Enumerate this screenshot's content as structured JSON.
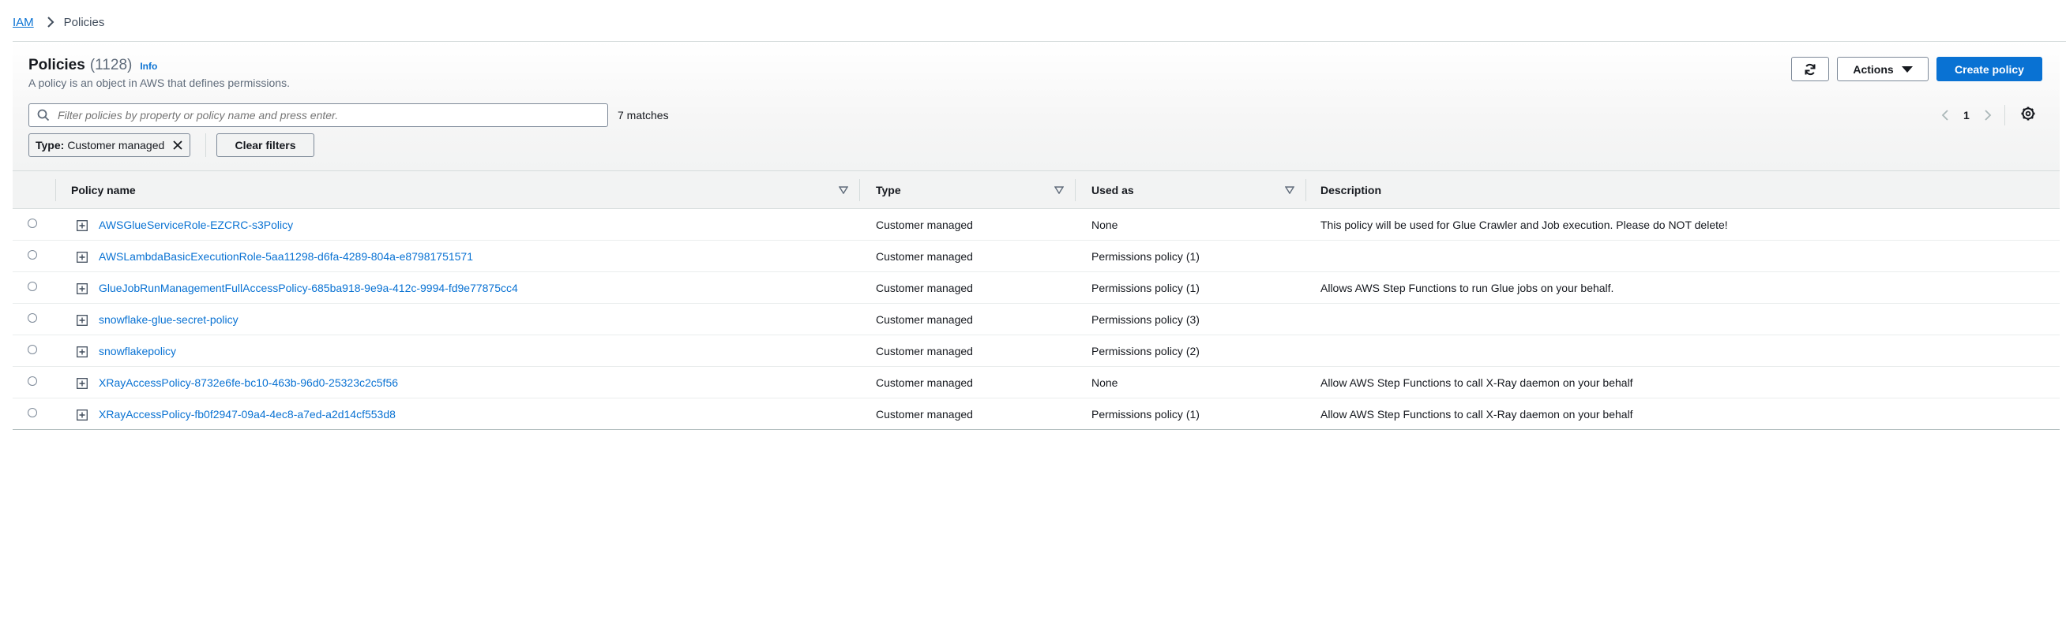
{
  "breadcrumb": {
    "root": "IAM",
    "current": "Policies"
  },
  "header": {
    "title": "Policies",
    "count": "(1128)",
    "info": "Info",
    "subtitle": "A policy is an object in AWS that defines permissions.",
    "actions_label": "Actions",
    "create_label": "Create policy"
  },
  "search": {
    "placeholder": "Filter policies by property or policy name and press enter.",
    "matches": "7 matches"
  },
  "pagination": {
    "page": "1"
  },
  "filter": {
    "key": "Type:",
    "value": "Customer managed",
    "clear_label": "Clear filters"
  },
  "table": {
    "columns": [
      "Policy name",
      "Type",
      "Used as",
      "Description"
    ],
    "rows": [
      {
        "name": "AWSGlueServiceRole-EZCRC-s3Policy",
        "type": "Customer managed",
        "used_as": "None",
        "description": "This policy will be used for Glue Crawler and Job execution. Please do NOT delete!"
      },
      {
        "name": "AWSLambdaBasicExecutionRole-5aa11298-d6fa-4289-804a-e87981751571",
        "type": "Customer managed",
        "used_as": "Permissions policy (1)",
        "description": ""
      },
      {
        "name": "GlueJobRunManagementFullAccessPolicy-685ba918-9e9a-412c-9994-fd9e77875cc4",
        "type": "Customer managed",
        "used_as": "Permissions policy (1)",
        "description": "Allows AWS Step Functions to run Glue jobs on your behalf."
      },
      {
        "name": "snowflake-glue-secret-policy",
        "type": "Customer managed",
        "used_as": "Permissions policy (3)",
        "description": ""
      },
      {
        "name": "snowflakepolicy",
        "type": "Customer managed",
        "used_as": "Permissions policy (2)",
        "description": ""
      },
      {
        "name": "XRayAccessPolicy-8732e6fe-bc10-463b-96d0-25323c2c5f56",
        "type": "Customer managed",
        "used_as": "None",
        "description": "Allow AWS Step Functions to call X-Ray daemon on your behalf"
      },
      {
        "name": "XRayAccessPolicy-fb0f2947-09a4-4ec8-a7ed-a2d14cf553d8",
        "type": "Customer managed",
        "used_as": "Permissions policy (1)",
        "description": "Allow AWS Step Functions to call X-Ray daemon on your behalf"
      }
    ]
  },
  "colors": {
    "link": "#0972d3",
    "primary": "#0972d3",
    "header_bg": "#f2f3f3"
  },
  "icons": [
    "chevron-right-icon",
    "refresh-icon",
    "caret-down-icon",
    "search-icon",
    "close-icon",
    "chevron-left-icon",
    "gear-icon",
    "sort-icon",
    "expand-plus-icon"
  ]
}
